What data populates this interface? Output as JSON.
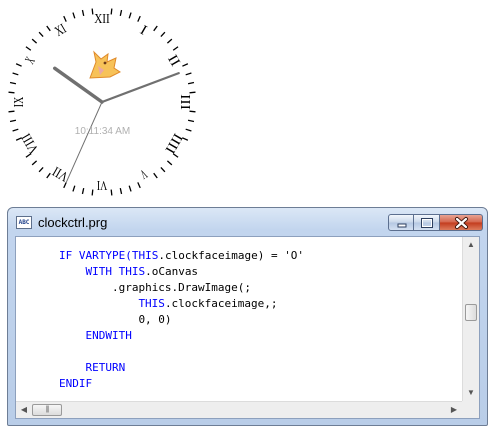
{
  "clock": {
    "time_text": "10:11:34 AM",
    "hour_numerals": [
      "XII",
      "I",
      "II",
      "III",
      "IIII",
      "V",
      "VI",
      "VII",
      "VIII",
      "IX",
      "X",
      "XI"
    ],
    "hands": {
      "hours": 10,
      "minutes": 11,
      "seconds": 34
    },
    "colors": {
      "hands": "#707070",
      "face_ticks": "#000000",
      "time_text": "#b0b0b0"
    }
  },
  "window": {
    "title": "clockctrl.prg",
    "app_icon_text": "ABC",
    "buttons": {
      "minimize": "minimize",
      "maximize": "maximize",
      "close": "close"
    }
  },
  "code": {
    "lines": [
      {
        "indent": 8,
        "parts": [
          {
            "t": "IF VARTYPE(",
            "k": true
          },
          {
            "t": "THIS",
            "k": true
          },
          {
            "t": ".clockfaceimage) = 'O'",
            "k": false
          }
        ]
      },
      {
        "indent": 12,
        "parts": [
          {
            "t": "WITH THIS",
            "k": true
          },
          {
            "t": ".oCanvas",
            "k": false
          }
        ]
      },
      {
        "indent": 16,
        "parts": [
          {
            "t": ".graphics.DrawImage(;",
            "k": false
          }
        ]
      },
      {
        "indent": 20,
        "parts": [
          {
            "t": "THIS",
            "k": true
          },
          {
            "t": ".clockfaceimage,;",
            "k": false
          }
        ]
      },
      {
        "indent": 20,
        "parts": [
          {
            "t": "0, 0)",
            "k": false
          }
        ]
      },
      {
        "indent": 12,
        "parts": [
          {
            "t": "ENDWITH",
            "k": true
          }
        ]
      },
      {
        "indent": 0,
        "parts": []
      },
      {
        "indent": 12,
        "parts": [
          {
            "t": "RETURN",
            "k": true
          }
        ]
      },
      {
        "indent": 8,
        "parts": [
          {
            "t": "ENDIF",
            "k": true
          }
        ]
      }
    ]
  },
  "colors": {
    "keyword": "#0000ff",
    "text": "#000000",
    "title_close": "#c23a1c"
  }
}
